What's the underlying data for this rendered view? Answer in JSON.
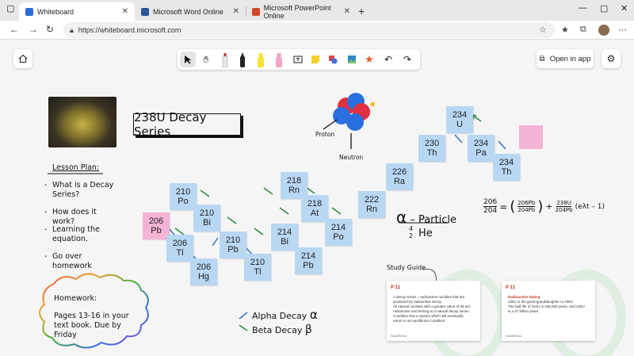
{
  "browser": {
    "tabs": [
      {
        "label": "Whiteboard",
        "active": true,
        "color": "#2b6cd8"
      },
      {
        "label": "Microsoft Word Online",
        "active": false,
        "color": "#2b579a"
      },
      {
        "label": "Microsoft PowerPoint Online",
        "active": false,
        "color": "#d24726"
      }
    ],
    "url": "https://whiteboard.microsoft.com"
  },
  "app": {
    "open_in_app_label": "Open in app",
    "tools": [
      "select-tool",
      "pan-tool",
      "eraser-tool",
      "black-pen",
      "yellow-highlighter",
      "pink-highlighter",
      "text-tool",
      "note-tool",
      "shapes-tool",
      "image-tool",
      "reactions-tool",
      "undo",
      "redo"
    ]
  },
  "board": {
    "title": "238U Decay Series",
    "lesson_plan": {
      "title": "Lesson Plan:",
      "items": [
        "What is a Decay Series?",
        "How does it work?",
        "Learning the equation.",
        "Go over homework"
      ]
    },
    "homework": {
      "title": "Homework:",
      "text": "Pages 13-16 in your text book. Due by Friday"
    },
    "atom_labels": {
      "proton": "Proton",
      "neutron": "Neutron"
    },
    "alpha_particle": {
      "label": "– Particle",
      "mass": "4",
      "charge": "2",
      "symbol": "He"
    },
    "legend": {
      "alpha": "Alpha Decay",
      "beta": "Beta Decay"
    },
    "study_guide_label": "Study Guide",
    "formula": {
      "lhs_num": "206",
      "lhs_den": "204",
      "rhs1_num": "206Pb",
      "rhs1_den": "204Pb",
      "rhs2_num": "238U",
      "rhs2_den": "204Pb",
      "tail": "(eλt – 1)"
    },
    "nuclides": [
      {
        "mass": "234",
        "sym": "U",
        "color": "blue"
      },
      {
        "mass": "230",
        "sym": "Th",
        "color": "blue"
      },
      {
        "mass": "234",
        "sym": "Pa",
        "color": "blue"
      },
      {
        "mass": "234",
        "sym": "Th",
        "color": "blue"
      },
      {
        "mass": "226",
        "sym": "Ra",
        "color": "blue"
      },
      {
        "mass": "222",
        "sym": "Rn",
        "color": "blue"
      },
      {
        "mass": "218",
        "sym": "Rn",
        "color": "blue"
      },
      {
        "mass": "218",
        "sym": "At",
        "color": "blue"
      },
      {
        "mass": "214",
        "sym": "Po",
        "color": "blue"
      },
      {
        "mass": "210",
        "sym": "Po",
        "color": "blue"
      },
      {
        "mass": "214",
        "sym": "Bi",
        "color": "blue"
      },
      {
        "mass": "210",
        "sym": "Bi",
        "color": "blue"
      },
      {
        "mass": "206",
        "sym": "Pb",
        "color": "pink"
      },
      {
        "mass": "206",
        "sym": "Tl",
        "color": "blue"
      },
      {
        "mass": "210",
        "sym": "Pb",
        "color": "blue"
      },
      {
        "mass": "214",
        "sym": "Pb",
        "color": "blue"
      },
      {
        "mass": "210",
        "sym": "Tl",
        "color": "blue"
      },
      {
        "mass": "206",
        "sym": "Hg",
        "color": "blue"
      }
    ],
    "cards": [
      {
        "title": "P 11",
        "heading": "",
        "bullets": [
          "A decay series = radioactive nuclides that are produced by radioactive decay.",
          "All natural nuclides with a greater value of 83 are radioactive and belong to 3 natural decay series.",
          "Condition that a system which will eventually return to an equilibrium condition"
        ],
        "footer": "WordPress"
      },
      {
        "title": "P 11",
        "heading": "Radioactive Dating",
        "bullets": [
          "238U is the great-granddaughter to 238U",
          "The half-life of 234U is 246,000 years, and 230U is 4.47 billion years"
        ],
        "footer": "WordPress"
      }
    ]
  }
}
